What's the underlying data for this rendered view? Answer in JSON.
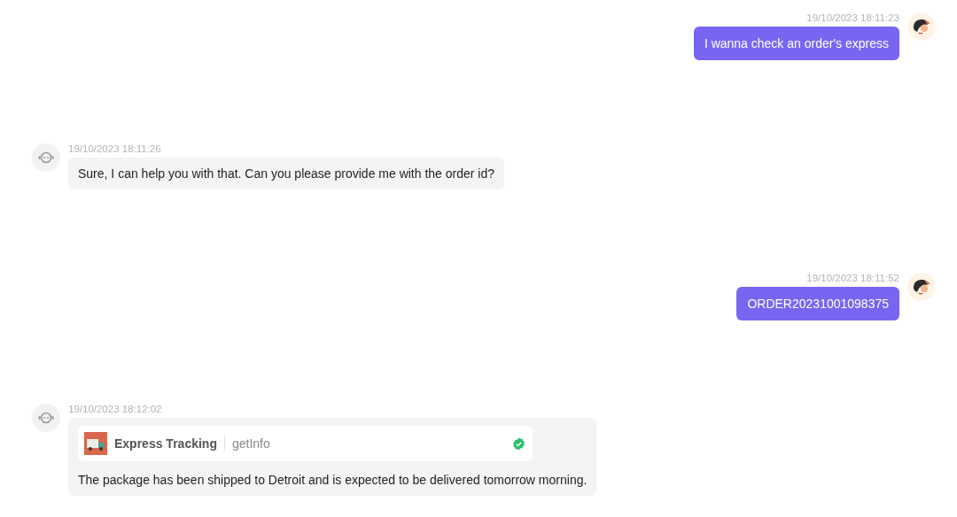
{
  "messages": [
    {
      "kind": "user",
      "time": "19/10/2023 18:11:23",
      "text": "I wanna check an order's express"
    },
    {
      "kind": "bot",
      "time": "19/10/2023 18:11:26",
      "text": "Sure, I can help you with that. Can you please provide me with the order id?"
    },
    {
      "kind": "user",
      "time": "19/10/2023 18:11:52",
      "text": "ORDER20231001098375"
    },
    {
      "kind": "bot",
      "time": "19/10/2023 18:12:02",
      "tool": {
        "name": "Express Tracking",
        "method": "getInfo",
        "done": true
      },
      "text": "The package has been shipped to Detroit and is expected to be delivered tomorrow morning."
    }
  ]
}
